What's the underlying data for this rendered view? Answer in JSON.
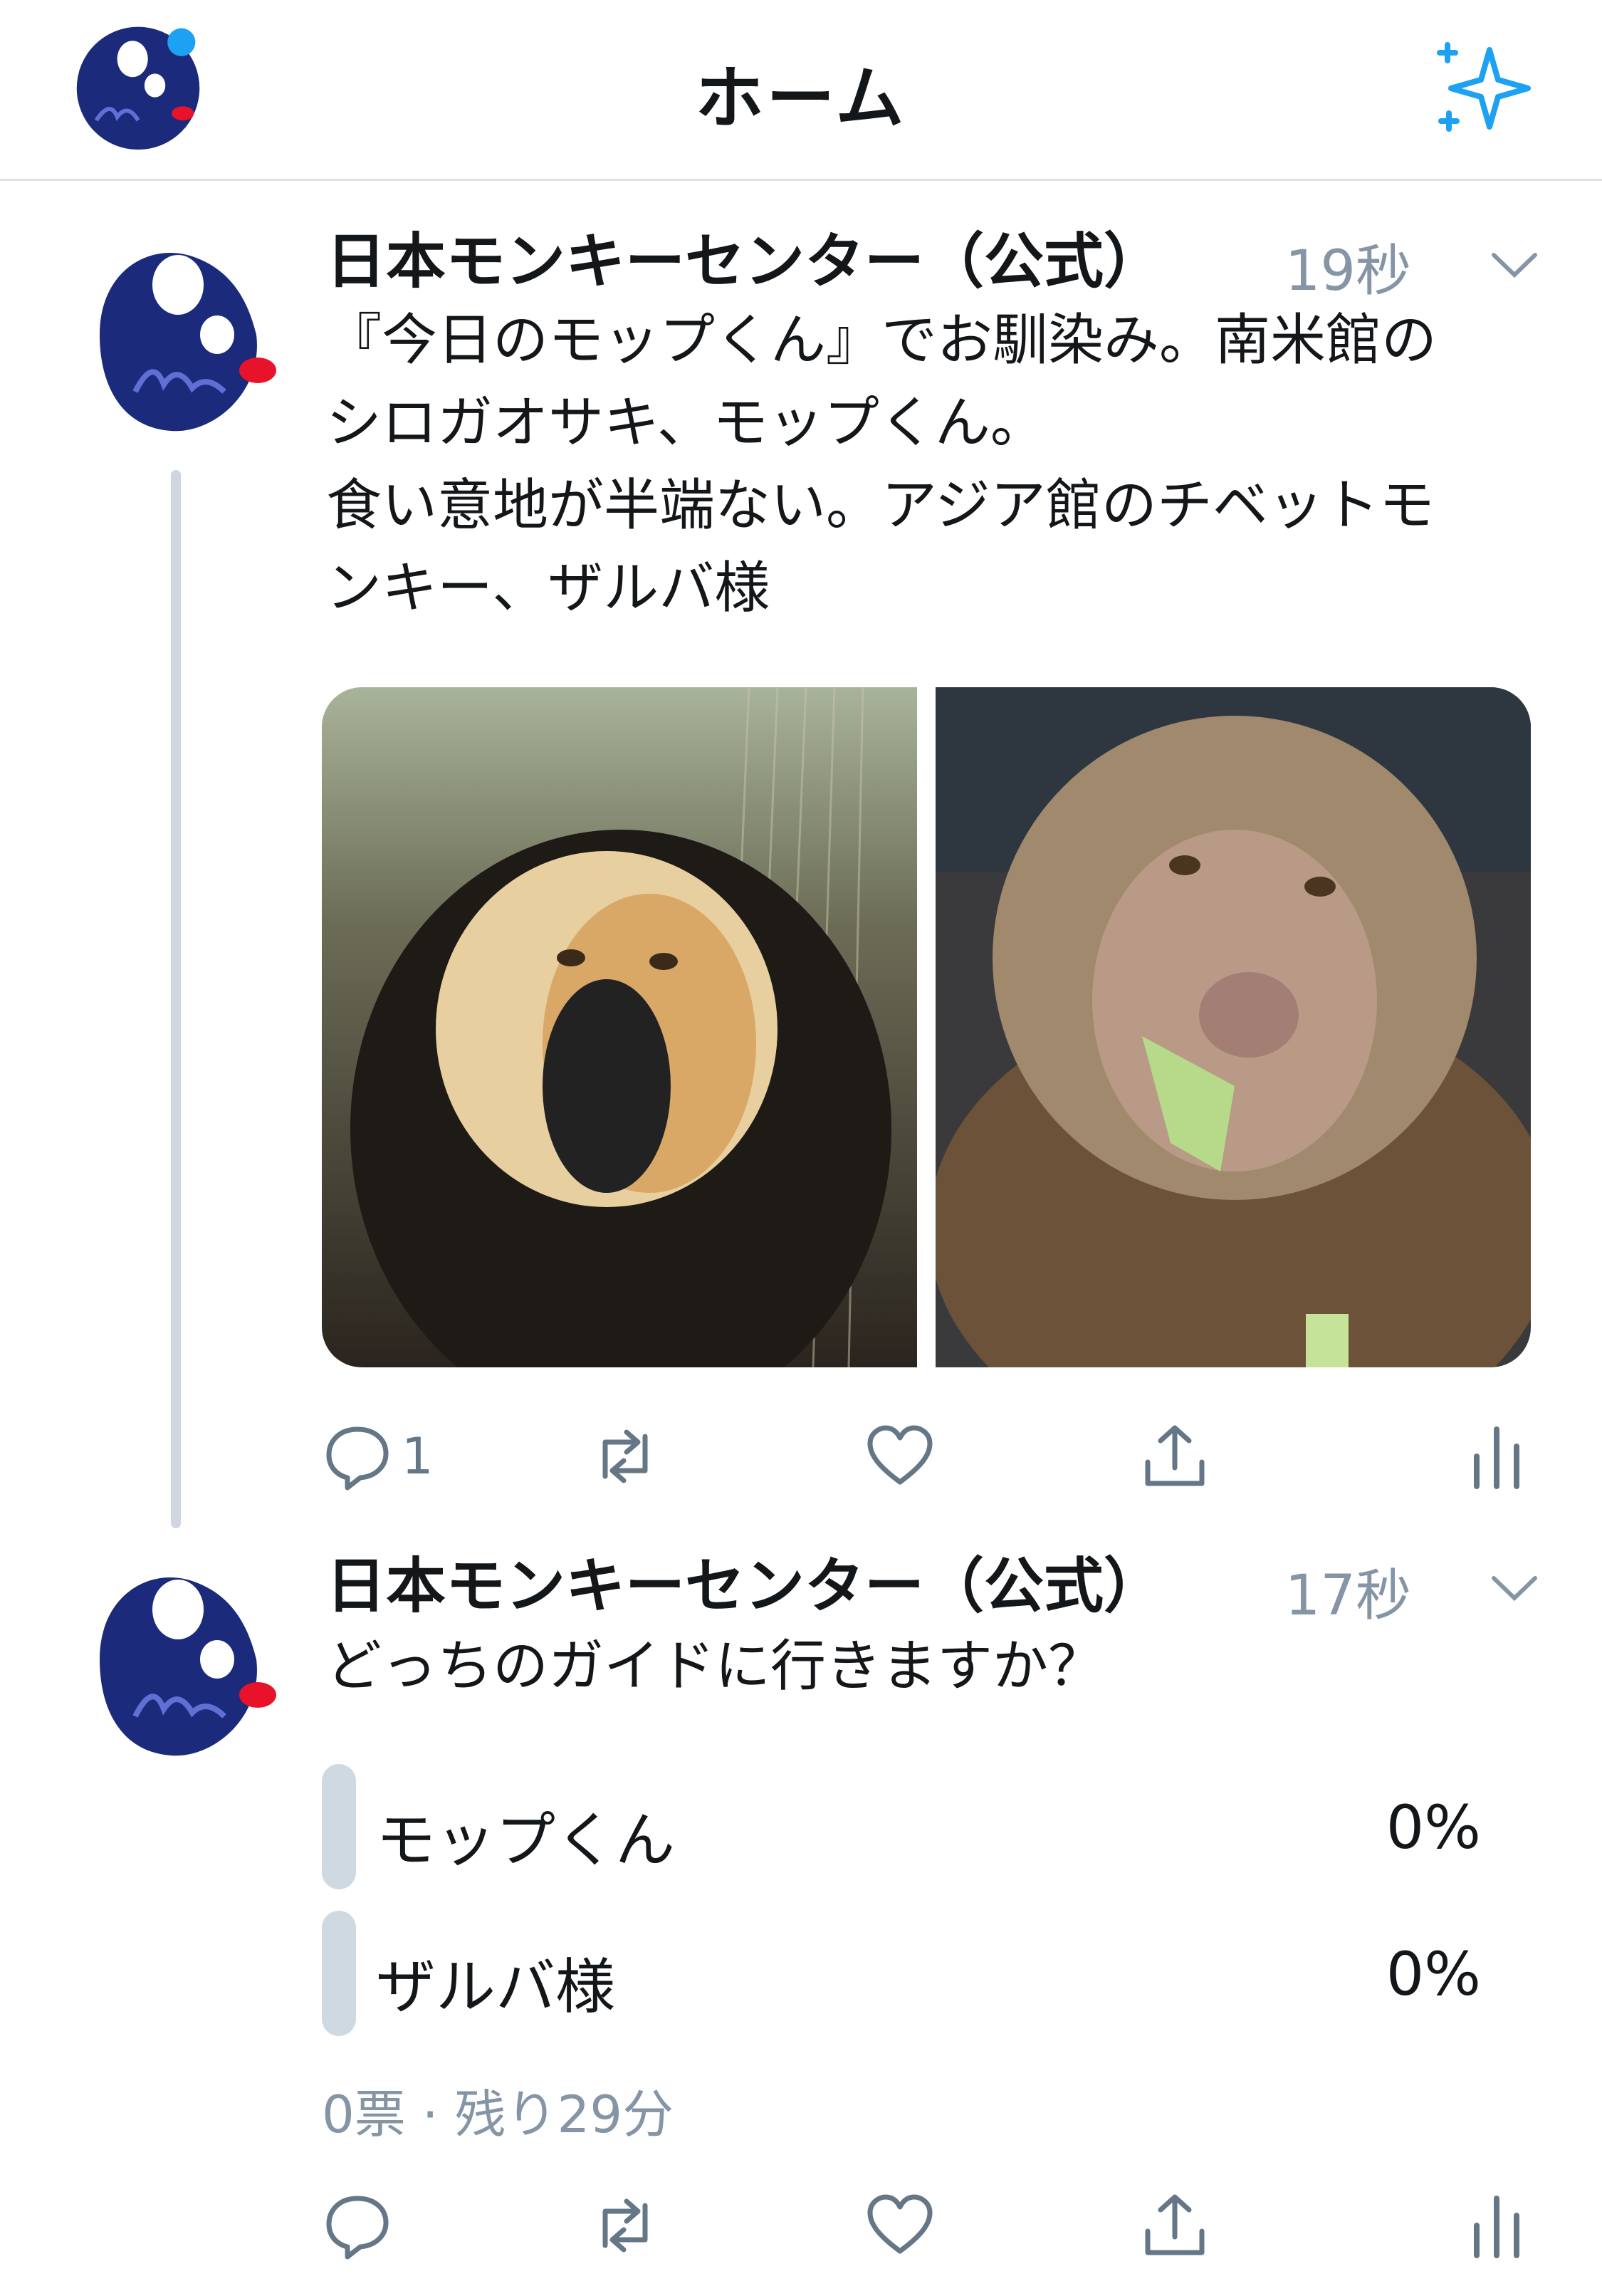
{
  "header": {
    "title": "ホーム",
    "sparkle_icon": "sparkle-icon"
  },
  "tweets": [
    {
      "name": "日本モンキーセンター（公式）",
      "time": "19秒",
      "text_lines": [
        "『今日のモップくん』でお馴染み。南米館の",
        "シロガオサキ、モップくん。",
        "食い意地が半端ない。アジア館のチベットモ",
        "ンキー、ザルバ様"
      ],
      "reply_count": "1"
    },
    {
      "name": "日本モンキーセンター（公式）",
      "time": "17秒",
      "text": "どっちのガイドに行きますか？",
      "poll": {
        "options": [
          {
            "label": "モップくん",
            "percent": "0%"
          },
          {
            "label": "ザルバ様",
            "percent": "0%"
          }
        ],
        "meta": "0票 · 残り29分"
      }
    }
  ],
  "colors": {
    "accent": "#1da1f2",
    "avatar_bg": "#1b2a7a",
    "muted": "#8595a6",
    "poll_bar": "#cfd9e2"
  }
}
